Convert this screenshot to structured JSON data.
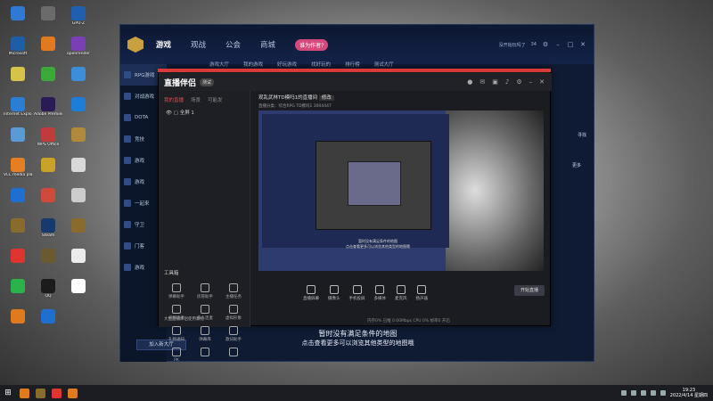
{
  "desktop": {
    "icons": [
      {
        "label": "",
        "color": "#2f78d3"
      },
      {
        "label": "",
        "color": "#6b6b6b"
      },
      {
        "label": "GPU-Z",
        "color": "#1f5fb0"
      },
      {
        "label": "Microsoft",
        "color": "#1e5ea8"
      },
      {
        "label": "",
        "color": "#e07a1f"
      },
      {
        "label": "openrender",
        "color": "#7a3fb5"
      },
      {
        "label": "",
        "color": "#d6c34a"
      },
      {
        "label": "",
        "color": "#3da83a"
      },
      {
        "label": "",
        "color": "#3b8ed9"
      },
      {
        "label": "Internet Explorer",
        "color": "#2a7fd4"
      },
      {
        "label": "Adobe Premiere",
        "color": "#2a1a55"
      },
      {
        "label": "",
        "color": "#1c7ed6"
      },
      {
        "label": "",
        "color": "#5a9ad6"
      },
      {
        "label": "WPS Office",
        "color": "#c23b3b"
      },
      {
        "label": "",
        "color": "#b08a3a"
      },
      {
        "label": "VLC media player",
        "color": "#e67e22"
      },
      {
        "label": "",
        "color": "#c9a227"
      },
      {
        "label": "",
        "color": "#d9d9d9"
      },
      {
        "label": "",
        "color": "#1f6fd0"
      },
      {
        "label": "",
        "color": "#d04a3a"
      },
      {
        "label": "",
        "color": "#cccccc"
      },
      {
        "label": "",
        "color": "#8a6b2e"
      },
      {
        "label": "Steam",
        "color": "#173a6e"
      },
      {
        "label": "",
        "color": "#8a6b2e"
      },
      {
        "label": "",
        "color": "#e0342e"
      },
      {
        "label": "",
        "color": "#6b5a2e"
      },
      {
        "label": "",
        "color": "#ececec"
      },
      {
        "label": "",
        "color": "#29b34a"
      },
      {
        "label": "QQ",
        "color": "#1b1b1b"
      },
      {
        "label": "",
        "color": "#ffffff"
      },
      {
        "label": "",
        "color": "#e07a1f"
      },
      {
        "label": "",
        "color": "#1f6fd0"
      }
    ]
  },
  "platform": {
    "nav": [
      "游戏",
      "观战",
      "公会",
      "商城"
    ],
    "badge": "谁为作者?",
    "user": "没开始玩吗了",
    "count": "34",
    "sub_tabs": [
      "游戏大厅",
      "我的游戏",
      "好玩游戏",
      "找好玩的",
      "排行榜",
      "测试大厅"
    ],
    "sidebar": [
      "RPG游戏",
      "对战游戏",
      "DOTA",
      "竞技",
      "游戏",
      "游戏",
      "一起来",
      "守卫",
      "门客",
      "游戏"
    ],
    "right_label": "寻找",
    "right_button": "更多",
    "map_empty_1": "暂时没有满足条件的地图",
    "map_empty_2": "点击查看更多可以浏览其他类型的地图哦",
    "room_button": "加入新大厅"
  },
  "obs": {
    "title": "直播伴侣",
    "version": "测试",
    "tabs": [
      "我的直播",
      "场景",
      "可能发"
    ],
    "scene": "全屏 1",
    "header_line1": "观乱武林TD模吗1的直播间",
    "header_line1_tag": "修改",
    "header_line2": "直播分类：综合RPG    TD模吗1    3004447",
    "tools_header": "工具箱",
    "tools": [
      "弹幕助手",
      "房管助手",
      "主播任务",
      "视频连麦",
      "多人连麦",
      "虚拟形象",
      "礼物通知",
      "弹幕库",
      "歌词助手",
      "PK",
      "",
      ""
    ],
    "left_footer": "大鱼直播伴侣使用教程",
    "preview_subtitle_1": "暂时没有满足条件的地图",
    "preview_subtitle_2": "点击查看更多可以浏览其他类型的地图哦",
    "bottom_buttons": [
      "直播屏幕",
      "摄像头",
      "手机投屏",
      "多媒体",
      "麦克风",
      "扬声器"
    ],
    "start_button": "开始直播",
    "status": "内存0%  已推  0.00Mbps  CPU 0%  帧率0  开启"
  },
  "taskbar": {
    "clock_time": "19:23",
    "clock_date": "2022/4/14 星期四",
    "apps": [
      {
        "color": "#e07a1f"
      },
      {
        "color": "#8a6b2e"
      },
      {
        "color": "#e0342e"
      },
      {
        "color": "#e07a1f"
      }
    ]
  }
}
